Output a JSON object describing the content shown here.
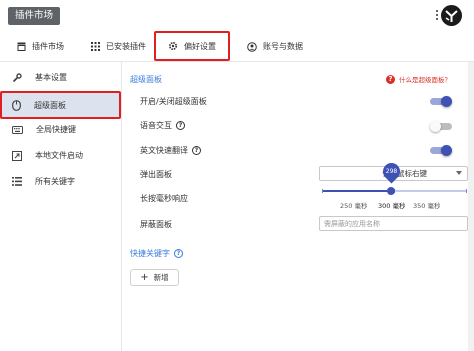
{
  "header": {
    "title": "插件市场"
  },
  "tabs": [
    {
      "label": "插件市场",
      "icon": "store-icon"
    },
    {
      "label": "已安装插件",
      "icon": "apps-grid-icon"
    },
    {
      "label": "偏好设置",
      "icon": "gear-icon",
      "active": true
    },
    {
      "label": "账号与数据",
      "icon": "account-icon"
    }
  ],
  "sidebar": {
    "items": [
      {
        "label": "基本设置",
        "icon": "wrench-icon"
      },
      {
        "label": "超级面板",
        "icon": "mouse-icon",
        "active": true
      },
      {
        "label": "全局快捷键",
        "icon": "keyboard-icon"
      },
      {
        "label": "本地文件启动",
        "icon": "open-file-icon"
      },
      {
        "label": "所有关键字",
        "icon": "list-icon"
      }
    ]
  },
  "main": {
    "section_title": "超级面板",
    "help_link": "什么是超级面板？",
    "rows": {
      "toggle_panel": {
        "label": "开启/关闭超级面板",
        "on": true
      },
      "voice": {
        "label": "语音交互",
        "on": false
      },
      "translate": {
        "label": "英文快速翻译",
        "on": true
      },
      "popup": {
        "label": "弹出面板",
        "value": "长按鼠标右键"
      },
      "longpress": {
        "label": "长按毫秒响应",
        "value": 298,
        "min": 250,
        "max": 350,
        "ticks": [
          "250 毫秒",
          "300 毫秒",
          "350 毫秒"
        ]
      },
      "block": {
        "label": "屏蔽面板",
        "placeholder": "需屏蔽的应用名称"
      }
    },
    "shortcut_title": "快捷关键字",
    "add_label": "新增"
  },
  "colors": {
    "accent": "#3f51b5",
    "link": "#3b7ddd",
    "highlight": "#e02020"
  }
}
